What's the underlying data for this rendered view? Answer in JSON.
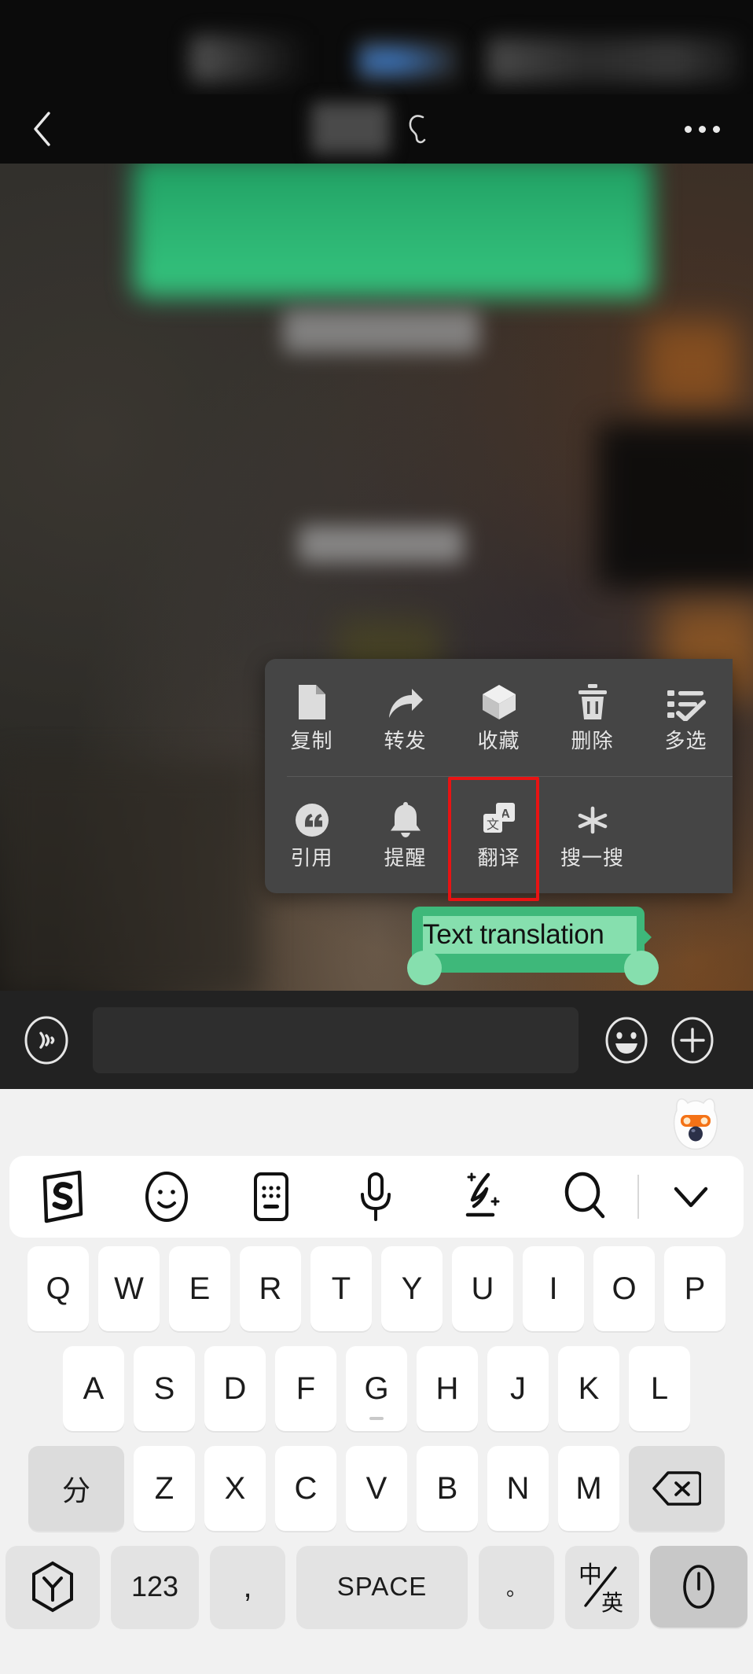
{
  "app": {
    "name": "WeChat chat",
    "theme": "dark",
    "accent_green": "#3eb87a",
    "selection_green": "#86dfae",
    "menu_bg": "#454545",
    "highlight_red": "#e81313"
  },
  "navbar": {
    "back_icon": "chevron-left-icon",
    "title": "",
    "title_redacted": true,
    "ear_icon": "ear-icon",
    "more_icon": "more-horizontal-icon"
  },
  "chat": {
    "background_blurred": true,
    "messages": [
      {
        "side": "right",
        "bubble_color": "#2bb271",
        "text": "",
        "redacted": true
      },
      {
        "side": "right",
        "bubble_color": "#3eb87a",
        "text": "Text translation",
        "selected": true
      }
    ]
  },
  "context_menu": {
    "rows": [
      [
        {
          "label": "复制",
          "icon": "copy-document-icon",
          "highlighted": false
        },
        {
          "label": "转发",
          "icon": "forward-arrow-icon",
          "highlighted": false
        },
        {
          "label": "收藏",
          "icon": "favorite-box-icon",
          "highlighted": false
        },
        {
          "label": "删除",
          "icon": "trash-icon",
          "highlighted": false
        },
        {
          "label": "多选",
          "icon": "multi-select-icon",
          "highlighted": false
        }
      ],
      [
        {
          "label": "引用",
          "icon": "quote-icon",
          "highlighted": false
        },
        {
          "label": "提醒",
          "icon": "bell-icon",
          "highlighted": false
        },
        {
          "label": "翻译",
          "icon": "translate-icon",
          "highlighted": true
        },
        {
          "label": "搜一搜",
          "icon": "search-sparkle-icon",
          "highlighted": false
        }
      ]
    ]
  },
  "input_bar": {
    "voice_icon": "voice-wave-icon",
    "text_value": "",
    "placeholder": "",
    "emoji_icon": "smiley-icon",
    "plus_icon": "plus-circle-icon"
  },
  "keyboard": {
    "mascot_icon": "sogou-fox-mascot-icon",
    "toolbar": [
      {
        "icon": "sogou-s-logo-icon",
        "label": "S"
      },
      {
        "icon": "emoji-face-icon",
        "label": ""
      },
      {
        "icon": "keypad-icon",
        "label": ""
      },
      {
        "icon": "microphone-icon",
        "label": ""
      },
      {
        "icon": "handwriting-pen-icon",
        "label": ""
      },
      {
        "icon": "search-icon",
        "label": ""
      },
      {
        "icon": "chevron-down-icon",
        "label": ""
      }
    ],
    "row1": [
      "Q",
      "W",
      "E",
      "R",
      "T",
      "Y",
      "U",
      "I",
      "O",
      "P"
    ],
    "row2": [
      "A",
      "S",
      "D",
      "F",
      "G",
      "H",
      "J",
      "K",
      "L"
    ],
    "row2_hint_key": "G",
    "row3_shift": "分",
    "row3": [
      "Z",
      "X",
      "C",
      "V",
      "B",
      "N",
      "M"
    ],
    "row3_backspace_icon": "backspace-icon",
    "bottom": {
      "hex_icon": "sogou-hexagon-icon",
      "num_label": "123",
      "comma_label": ",",
      "space_label": "SPACE",
      "period_label": "。",
      "lang_top": "中",
      "lang_bottom": "英",
      "lang_label": "中/英",
      "enter_icon": "enter-key-icon"
    }
  }
}
